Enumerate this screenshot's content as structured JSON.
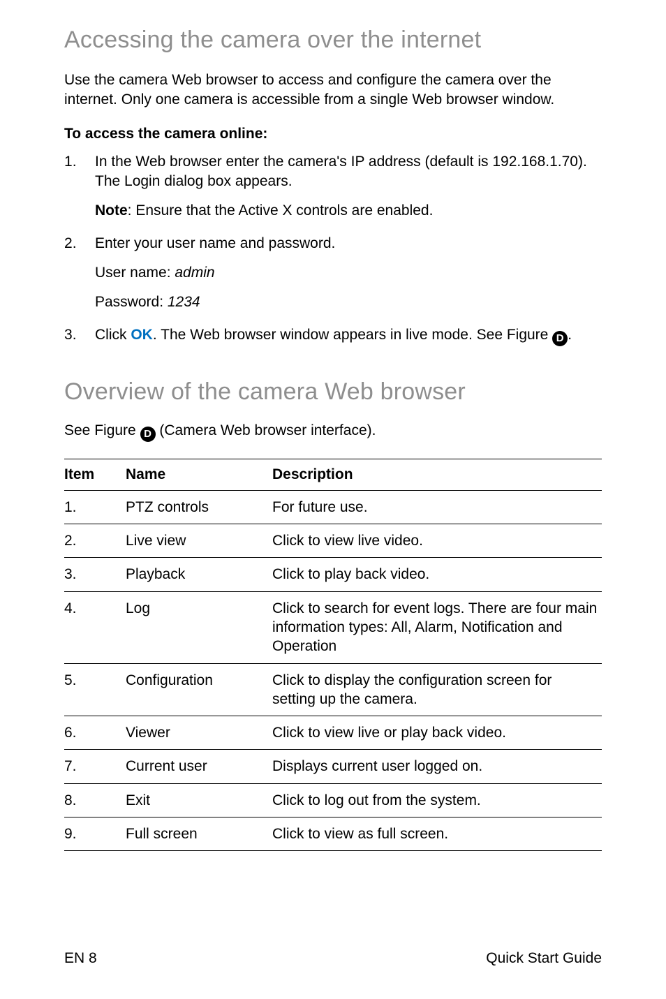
{
  "section1": {
    "heading": "Accessing the camera over the internet",
    "intro": "Use the camera Web browser to access and configure the camera over the internet. Only one camera is accessible from a single Web browser window.",
    "proc_title": "To access the camera online:",
    "step1": "In the Web browser enter the camera's IP address (default is 192.168.1.70). The Login dialog box appears.",
    "step1_note_label": "Note",
    "step1_note_text": ": Ensure that the Active X controls are enabled.",
    "step2": "Enter your user name and password.",
    "step2_user_label": "User name: ",
    "step2_user_value": "admin",
    "step2_pass_label": "Password: ",
    "step2_pass_value": "1234",
    "step3_prefix": "Click ",
    "step3_ok": "OK",
    "step3_mid": ". The Web browser window appears in live mode. See Figure ",
    "step3_letter": "D",
    "step3_suffix": "."
  },
  "section2": {
    "heading": "Overview of the camera Web browser",
    "see_prefix": "See Figure ",
    "see_letter": "D",
    "see_suffix": " (Camera Web browser interface)."
  },
  "table": {
    "headers": {
      "item": "Item",
      "name": "Name",
      "desc": "Description"
    },
    "rows": [
      {
        "item": "1.",
        "name": "PTZ controls",
        "desc": "For future use."
      },
      {
        "item": "2.",
        "name": "Live view",
        "desc": "Click to view live video."
      },
      {
        "item": "3.",
        "name": "Playback",
        "desc": "Click to play back video."
      },
      {
        "item": "4.",
        "name": "Log",
        "desc": "Click to search for event logs. There are four main information types: All, Alarm, Notification and Operation"
      },
      {
        "item": "5.",
        "name": "Configuration",
        "desc": "Click to display the configuration screen for setting up the camera."
      },
      {
        "item": "6.",
        "name": "Viewer",
        "desc": "Click to view live or play back video."
      },
      {
        "item": "7.",
        "name": "Current user",
        "desc": "Displays current user logged on."
      },
      {
        "item": "8.",
        "name": "Exit",
        "desc": "Click to log out  from the system."
      },
      {
        "item": "9.",
        "name": "Full screen",
        "desc": "Click to view as full screen."
      }
    ]
  },
  "footer": {
    "left": "EN 8",
    "right": "Quick Start Guide"
  }
}
